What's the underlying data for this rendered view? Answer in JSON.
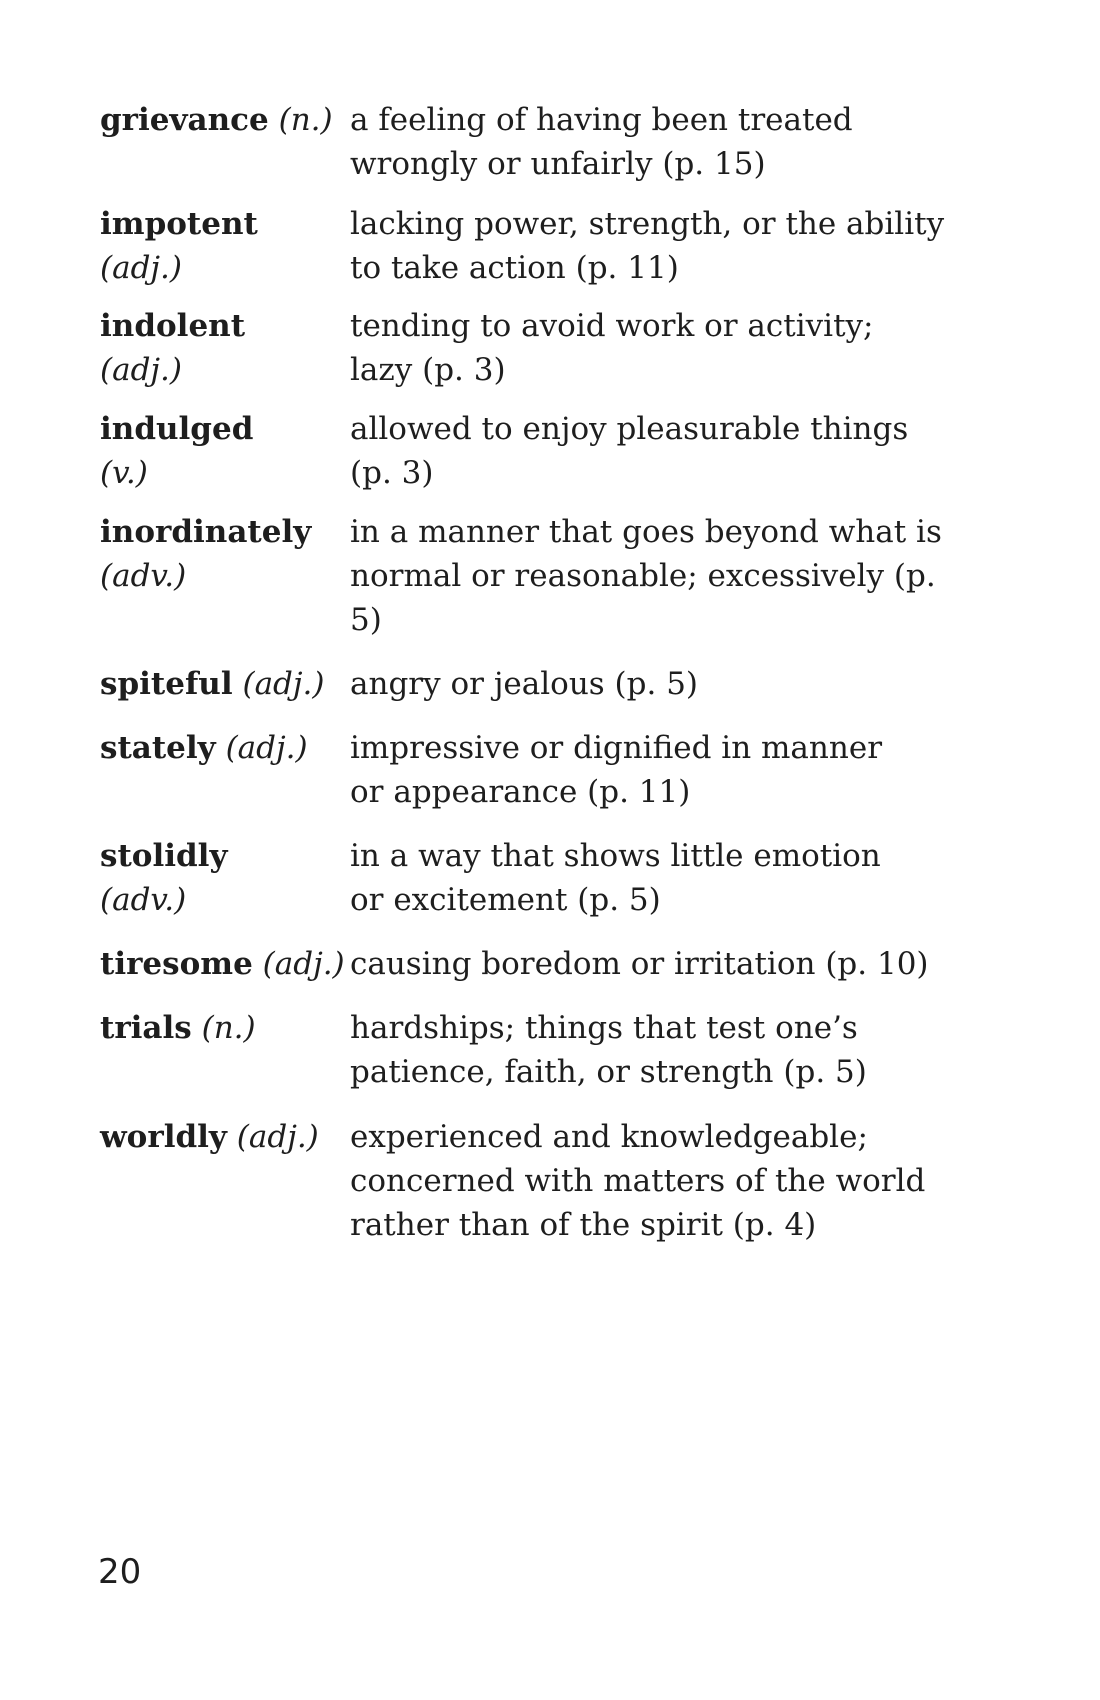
{
  "glossary": {
    "entries": [
      {
        "term": "grievance",
        "pos": "(n.)",
        "definition": "a feeling of having been treated\nwrongly or unfairly (p. 15)"
      },
      {
        "term": "impotent",
        "pos": "(adj.)",
        "definition": "lacking power, strength, or the ability\nto take action (p. 11)"
      },
      {
        "term": "indolent",
        "pos": "(adj.)",
        "definition": "tending to avoid work or activity;\nlazy (p. 3)"
      },
      {
        "term": "indulged",
        "pos": "(v.)",
        "definition": "allowed to enjoy pleasurable things\n(p. 3)"
      },
      {
        "term": "inordinately",
        "pos": "(adv.)",
        "definition": "in a manner that goes beyond what is\nnormal or reasonable; excessively (p. 5)"
      },
      {
        "term": "spiteful",
        "pos": "(adj.)",
        "definition": "angry or jealous (p. 5)"
      },
      {
        "term": "stately",
        "pos": "(adj.)",
        "definition": "impressive or dignified in manner\nor appearance (p. 11)"
      },
      {
        "term": "stolidly",
        "pos": "(adv.)",
        "definition": "in a way that shows little emotion\nor excitement (p. 5)"
      },
      {
        "term": "tiresome",
        "pos": "(adj.)",
        "definition": "causing boredom or irritation (p. 10)"
      },
      {
        "term": "trials",
        "pos": "(n.)",
        "definition": "hardships; things that test one’s\npatience, faith, or strength (p. 5)"
      },
      {
        "term": "worldly",
        "pos": "(adj.)",
        "definition": "experienced and knowledgeable;\nconcerned with matters of the world\nrather than of the spirit (p. 4)"
      }
    ]
  },
  "page_number": "20"
}
